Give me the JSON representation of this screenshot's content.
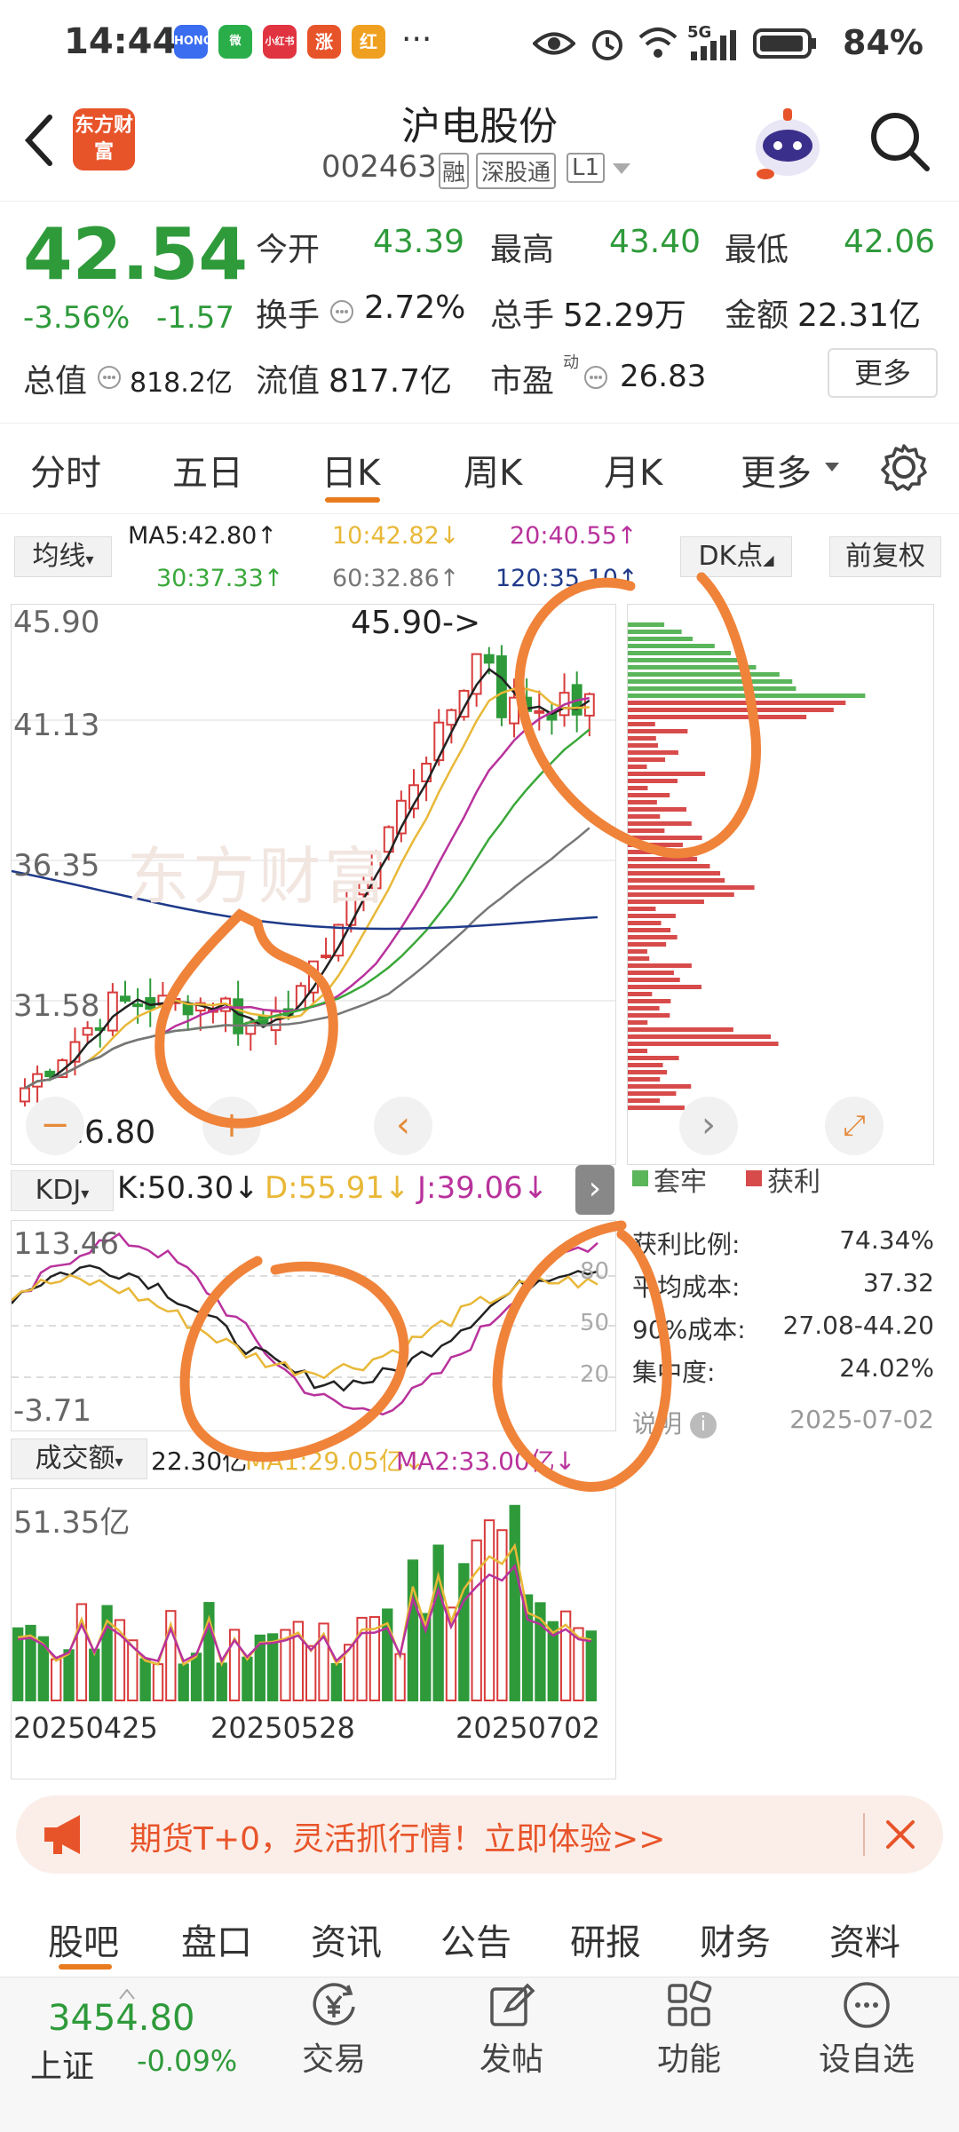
{
  "status_bar": {
    "time": "14:44",
    "apps": [
      {
        "name": "HONOR",
        "color": "#3a6df0"
      },
      {
        "name": "微",
        "color": "#2aae4a"
      },
      {
        "name": "小红书",
        "color": "#e03440"
      },
      {
        "name": "涨",
        "color": "#e8542a"
      },
      {
        "name": "红",
        "color": "#f0a020"
      }
    ],
    "more": "···",
    "network": "5G",
    "battery": "84%"
  },
  "header": {
    "back_icon": "chevron-left-icon",
    "logo_text": "东方财富",
    "title": "沪电股份",
    "code": "002463",
    "tags": [
      "融",
      "深股通",
      "L1"
    ],
    "search_icon": "search-icon"
  },
  "quote": {
    "price": "42.54",
    "change_pct": "-3.56%",
    "change": "-1.57",
    "open_label": "今开",
    "open": "43.39",
    "high_label": "最高",
    "high": "43.40",
    "low_label": "最低",
    "low": "42.06",
    "turnover_label": "换手",
    "turnover": "2.72%",
    "volume_label": "总手",
    "volume": "52.29万",
    "amount_label": "金额",
    "amount": "22.31亿",
    "mktcap_label": "总值",
    "mktcap": "818.2亿",
    "float_label": "流值",
    "float": "817.7亿",
    "pe_label": "市盈",
    "pe_sup": "动",
    "pe": "26.83",
    "more_button": "更多"
  },
  "tabs": {
    "items": [
      "分时",
      "五日",
      "日K",
      "周K",
      "月K",
      "更多"
    ],
    "active": "日K",
    "settings_icon": "gear-icon"
  },
  "kline": {
    "ma_selector": "均线",
    "ma5": "MA5:42.80↑",
    "ma10": "10:42.82↓",
    "ma20": "20:40.55↑",
    "ma30": "30:37.33↑",
    "ma60": "60:32.86↑",
    "ma120": "120:35.10↑",
    "dk_button": "DK点",
    "fq_button": "前复权",
    "y_ticks": [
      "45.90",
      "41.13",
      "36.35",
      "31.58",
      "26.80"
    ],
    "max_label": "45.90->",
    "min_label": "<-26.80",
    "watermark": "东方财富",
    "colors": {
      "up": "#d83b3b",
      "down": "#2e9a3a",
      "ma5": "#222222",
      "ma10": "#e8b838",
      "ma20": "#b8329c",
      "ma30": "#3aa83a",
      "ma60": "#777777",
      "ma120": "#1f3a8a"
    }
  },
  "chips": {
    "legend_hold": "套牢",
    "legend_profit": "获利",
    "rows": [
      {
        "label": "获利比例:",
        "value": "74.34%"
      },
      {
        "label": "平均成本:",
        "value": "37.32"
      },
      {
        "label": "90%成本:",
        "value": "27.08-44.20"
      },
      {
        "label": "集中度:",
        "value": "24.02%"
      }
    ],
    "note_label": "说明",
    "date": "2025-07-02"
  },
  "kdj": {
    "selector": "KDJ",
    "k": "K:50.30↓",
    "d": "D:55.91↓",
    "j": "J:39.06↓",
    "y_top": "113.46",
    "y_bottom": "-3.71",
    "levels": [
      "80",
      "50",
      "20"
    ]
  },
  "volume": {
    "selector": "成交额",
    "value": "22.30亿",
    "ma1": "MA1:29.05亿↓",
    "ma2": "MA2:33.00亿↓",
    "y_top": "51.35亿",
    "dates": [
      "20250425",
      "20250528",
      "20250702"
    ]
  },
  "banner": {
    "text": "期货T+0，灵活抓行情！立即体验>>",
    "icon": "megaphone-icon",
    "close_icon": "close-icon"
  },
  "bottom_tabs": {
    "items": [
      "股吧",
      "盘口",
      "资讯",
      "公告",
      "研报",
      "财务",
      "资料"
    ],
    "active": "股吧"
  },
  "bottom_nav": {
    "index_value": "3454.80",
    "index_name": "上证",
    "index_change": "-0.09%",
    "items": [
      {
        "label": "交易",
        "icon": "trade-icon"
      },
      {
        "label": "发帖",
        "icon": "edit-icon"
      },
      {
        "label": "功能",
        "icon": "grid-icon"
      },
      {
        "label": "设自选",
        "icon": "more-circle-icon"
      }
    ]
  }
}
